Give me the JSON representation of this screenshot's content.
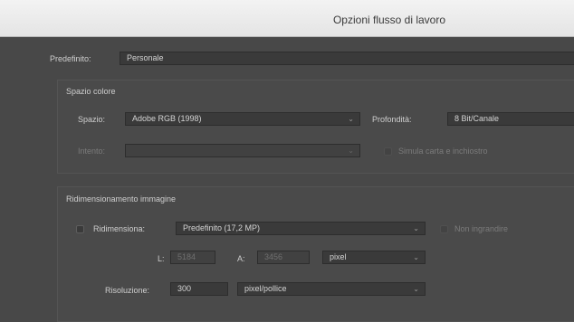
{
  "window": {
    "title": "Opzioni flusso di lavoro"
  },
  "preset": {
    "label": "Predefinito:",
    "value": "Personale"
  },
  "color_space": {
    "group_title": "Spazio colore",
    "space_label": "Spazio:",
    "space_value": "Adobe RGB (1998)",
    "depth_label": "Profondità:",
    "depth_value": "8 Bit/Canale",
    "intent_label": "Intento:",
    "intent_value": "",
    "simulate_label": "Simula carta e inchiostro"
  },
  "resize": {
    "group_title": "Ridimensionamento immagine",
    "resize_label": "Ridimensiona:",
    "resize_value": "Predefinito (17,2 MP)",
    "no_enlarge_label": "Non ingrandire",
    "width_label": "L:",
    "width_value": "5184",
    "height_label": "A:",
    "height_value": "3456",
    "unit_value": "pixel",
    "resolution_label": "Risoluzione:",
    "resolution_value": "300",
    "resolution_unit_value": "pixel/pollice"
  }
}
